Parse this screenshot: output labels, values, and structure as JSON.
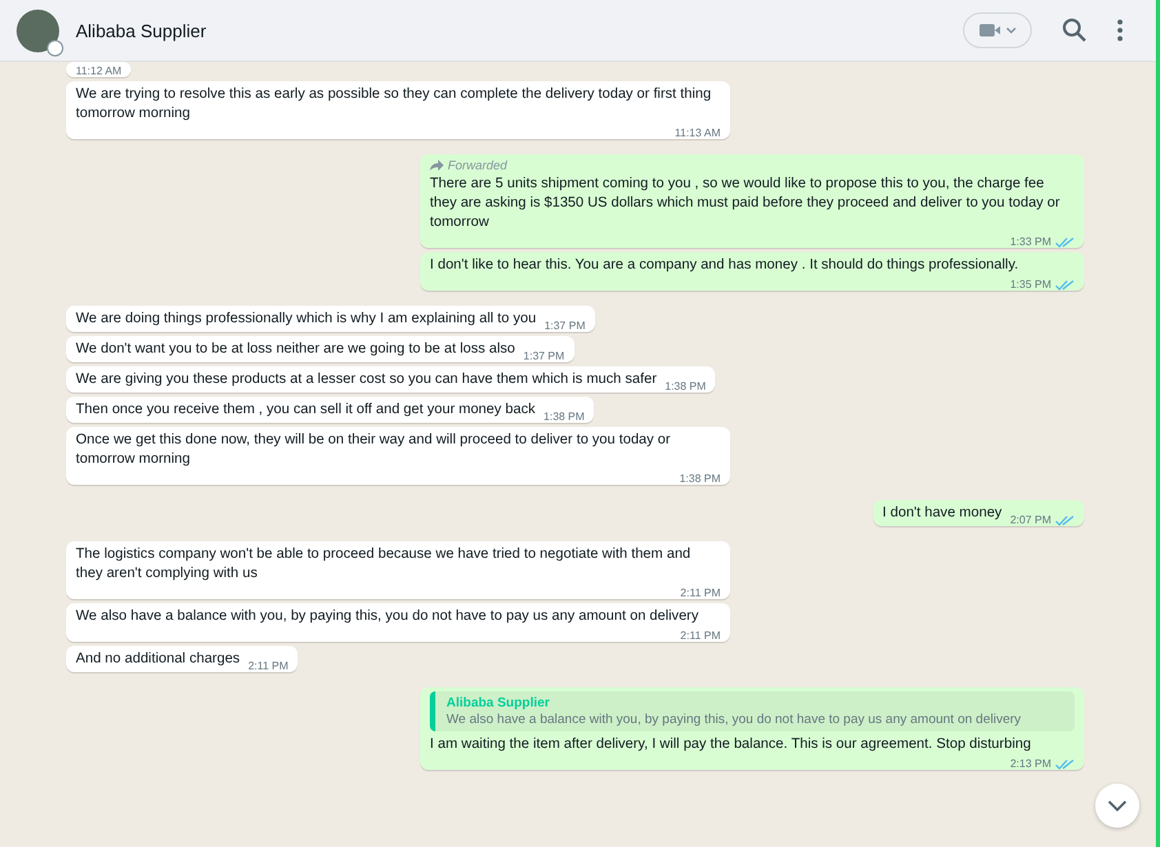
{
  "header": {
    "contact_name": "Alibaba Supplier"
  },
  "messages": [
    {
      "kind": "incoming",
      "time": "11:12 AM"
    },
    {
      "kind": "incoming",
      "text": "We are trying to resolve this as early as possible so they can complete the delivery today or first thing tomorrow morning",
      "time": "11:13 AM"
    },
    {
      "kind": "outgoing",
      "forwarded": "Forwarded",
      "text": "There are 5 units shipment coming to you , so we would like to propose this to you, the charge fee they are asking is $1350 US dollars which must paid before they proceed and deliver to you today or tomorrow",
      "time": "1:33 PM",
      "read": true
    },
    {
      "kind": "outgoing",
      "text": "I don't like to hear this. You are a company and has money . It should do things professionally.",
      "time": "1:35 PM",
      "read": true
    },
    {
      "kind": "incoming",
      "text": "We are doing things professionally which is why I am explaining all to you",
      "time": "1:37 PM"
    },
    {
      "kind": "incoming",
      "text": "We don't want you to be at loss neither are we going to be at loss also",
      "time": "1:37 PM"
    },
    {
      "kind": "incoming",
      "text": "We are giving you these products at a lesser cost so you can have them which is much safer",
      "time": "1:38 PM"
    },
    {
      "kind": "incoming",
      "text": "Then once you receive them , you can sell it off and get your money back",
      "time": "1:38 PM"
    },
    {
      "kind": "incoming",
      "text": "Once we get this done now, they will be on their way and will proceed to deliver to you today or tomorrow morning",
      "time": "1:38 PM"
    },
    {
      "kind": "outgoing",
      "text": "I don't have money",
      "time": "2:07 PM",
      "read": true
    },
    {
      "kind": "incoming",
      "text": "The logistics company won't be able to proceed because we have tried to negotiate with them and they aren't complying with us",
      "time": "2:11 PM"
    },
    {
      "kind": "incoming",
      "text": "We also have a balance with you, by paying this, you do not have to pay us any amount on delivery",
      "time": "2:11 PM"
    },
    {
      "kind": "incoming",
      "text": "And no additional charges",
      "time": "2:11 PM"
    },
    {
      "kind": "outgoing",
      "quote": {
        "author": "Alibaba Supplier",
        "text": "We also have a balance with you, by paying this, you do not have to pay us any amount on delivery"
      },
      "text": "I am waiting the item after delivery, I will pay the balance.  This is our agreement. Stop disturbing",
      "time": "2:13 PM",
      "read": true
    }
  ]
}
